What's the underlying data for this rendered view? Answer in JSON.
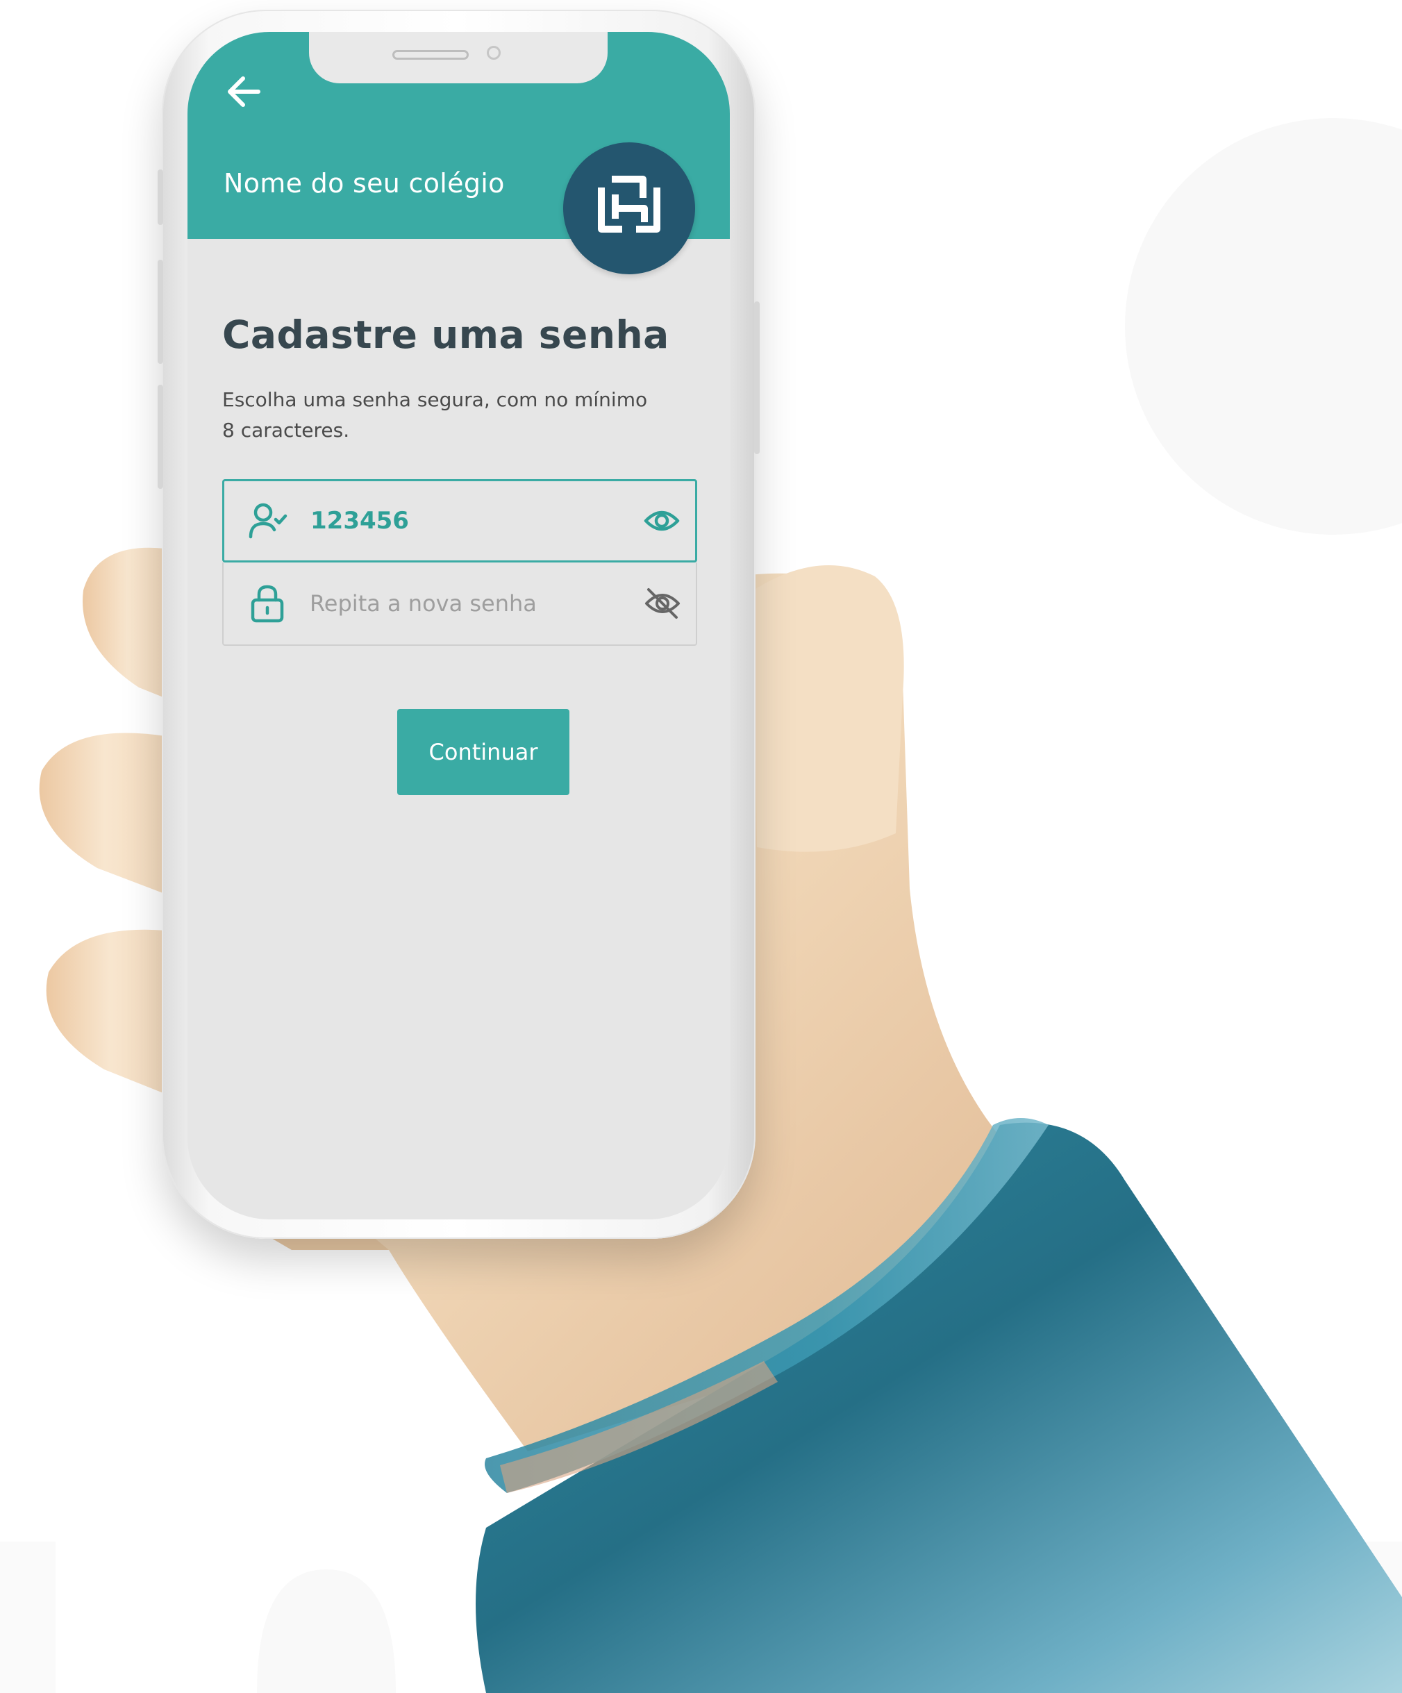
{
  "header": {
    "school_name": "Nome do seu colégio"
  },
  "main": {
    "title": "Cadastre uma senha",
    "instructions_line1": "Escolha uma senha segura, com no mínimo",
    "instructions_line2": "8 caracteres."
  },
  "form": {
    "password_value": "123456",
    "confirm_placeholder": "Repita a nova senha",
    "continue_label": "Continuar"
  },
  "icons": {
    "back": "arrow-left-icon",
    "user": "user-check-icon",
    "lock": "lock-icon",
    "show": "eye-icon",
    "hide": "eye-off-icon"
  },
  "colors": {
    "accent": "#3aaba4",
    "logo_bg": "#24566f",
    "screen_bg": "#e6e6e6",
    "title_text": "#37474f",
    "sleeve": "#2b7f95",
    "skin": "#f2dcc0"
  }
}
